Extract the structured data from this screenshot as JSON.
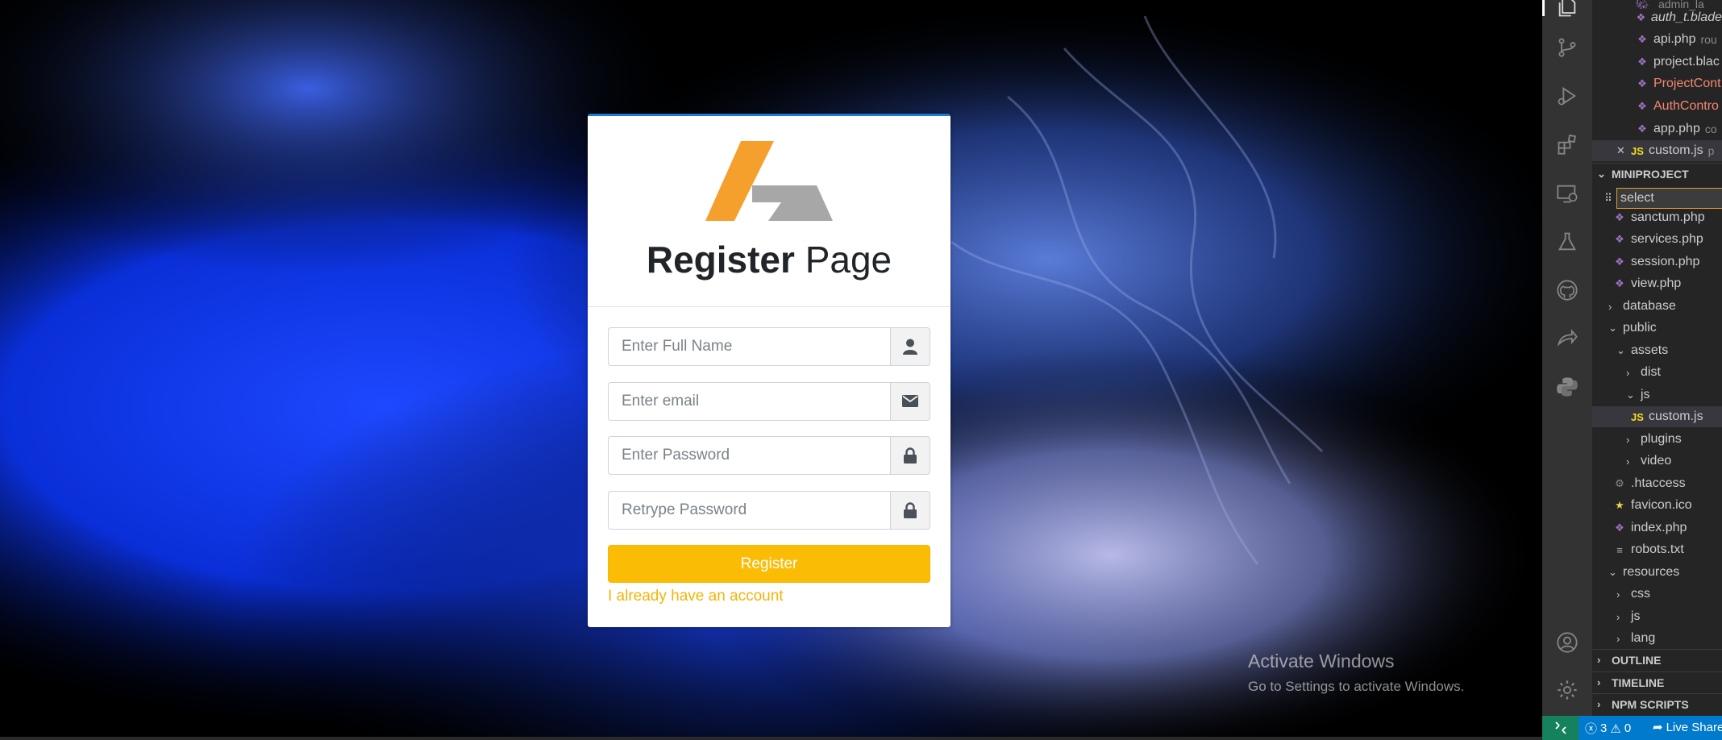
{
  "register_page": {
    "title_bold": "Register",
    "title_light": "Page",
    "full_name_placeholder": "Enter Full Name",
    "email_placeholder": "Enter email",
    "password_placeholder": "Enter Password",
    "retype_placeholder": "Retrype Password",
    "register_button": "Register",
    "login_link": "I already have an account"
  },
  "watermark": {
    "line1": "Activate Windows",
    "line2": "Go to Settings to activate Windows."
  },
  "vscode": {
    "open_editors": [
      {
        "name": "auth_t.blade",
        "icon": "php-icon",
        "style": "italic"
      },
      {
        "name": "api.php",
        "icon": "php-icon",
        "hint": "rou"
      },
      {
        "name": "project.blac",
        "icon": "php-icon"
      },
      {
        "name": "ProjectCont",
        "icon": "php-icon",
        "style": "modified"
      },
      {
        "name": "AuthContro",
        "icon": "php-icon",
        "style": "modified"
      },
      {
        "name": "app.php",
        "icon": "php-icon",
        "hint": "co"
      },
      {
        "name": "custom.js",
        "icon": "js-icon",
        "hint": "p"
      }
    ],
    "project_title": "MINIPROJECT",
    "filter_value": "select",
    "tree": [
      {
        "name": "sanctum.php",
        "icon": "php-icon"
      },
      {
        "name": "services.php",
        "icon": "php-icon"
      },
      {
        "name": "session.php",
        "icon": "php-icon"
      },
      {
        "name": "view.php",
        "icon": "php-icon"
      },
      {
        "name": "database",
        "icon": "folder-collapsed"
      },
      {
        "name": "public",
        "icon": "folder-expanded"
      },
      {
        "name": "assets",
        "icon": "folder-expanded"
      },
      {
        "name": "dist",
        "icon": "folder-collapsed"
      },
      {
        "name": "js",
        "icon": "folder-expanded"
      },
      {
        "name": "custom.js",
        "icon": "js-icon"
      },
      {
        "name": "plugins",
        "icon": "folder-collapsed"
      },
      {
        "name": "video",
        "icon": "folder-collapsed"
      },
      {
        "name": ".htaccess",
        "icon": "gear-icon"
      },
      {
        "name": "favicon.ico",
        "icon": "star-icon"
      },
      {
        "name": "index.php",
        "icon": "php-icon"
      },
      {
        "name": "robots.txt",
        "icon": "text-file-icon"
      },
      {
        "name": "resources",
        "icon": "folder-expanded"
      },
      {
        "name": "css",
        "icon": "folder-collapsed"
      },
      {
        "name": "js",
        "icon": "folder-collapsed"
      },
      {
        "name": "lang",
        "icon": "folder-collapsed"
      }
    ],
    "sections": [
      "OUTLINE",
      "TIMELINE",
      "NPM SCRIPTS"
    ],
    "status": {
      "errors": "3",
      "warnings": "0",
      "live_share": "Live Share"
    }
  }
}
